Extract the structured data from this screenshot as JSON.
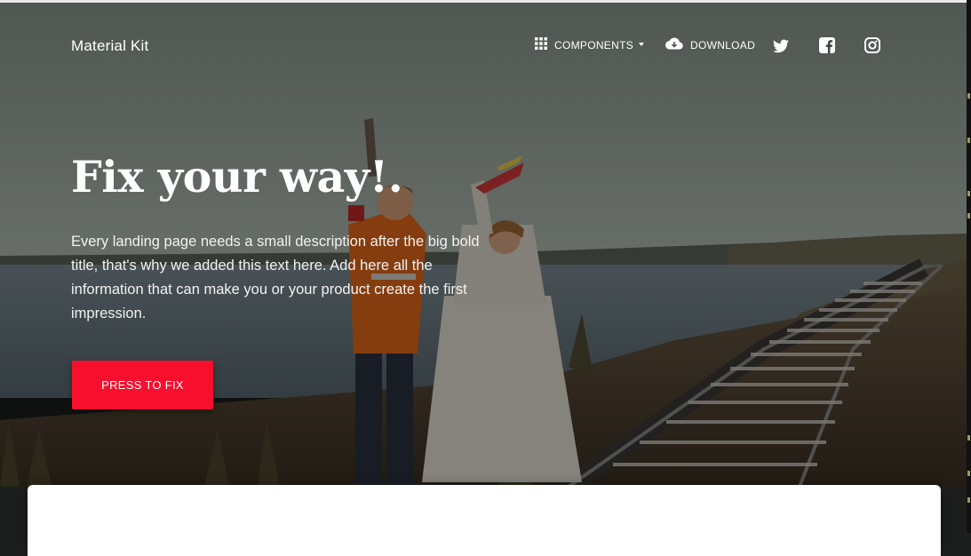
{
  "navbar": {
    "brand": "Material Kit",
    "components_label": "COMPONENTS",
    "download_label": "DOWNLOAD",
    "social": [
      "twitter-icon",
      "facebook-icon",
      "instagram-icon"
    ]
  },
  "hero": {
    "title": "Fix your way!.",
    "description": "Every landing page needs a small description after the big bold title, that's why we added this text here. Add here all the information that can make you or your product create the first impression.",
    "cta_label": "PRESS TO FIX"
  },
  "colors": {
    "accent": "#f70f2d",
    "overlay": "rgba(0,0,0,0.42)",
    "text": "#ffffff"
  }
}
